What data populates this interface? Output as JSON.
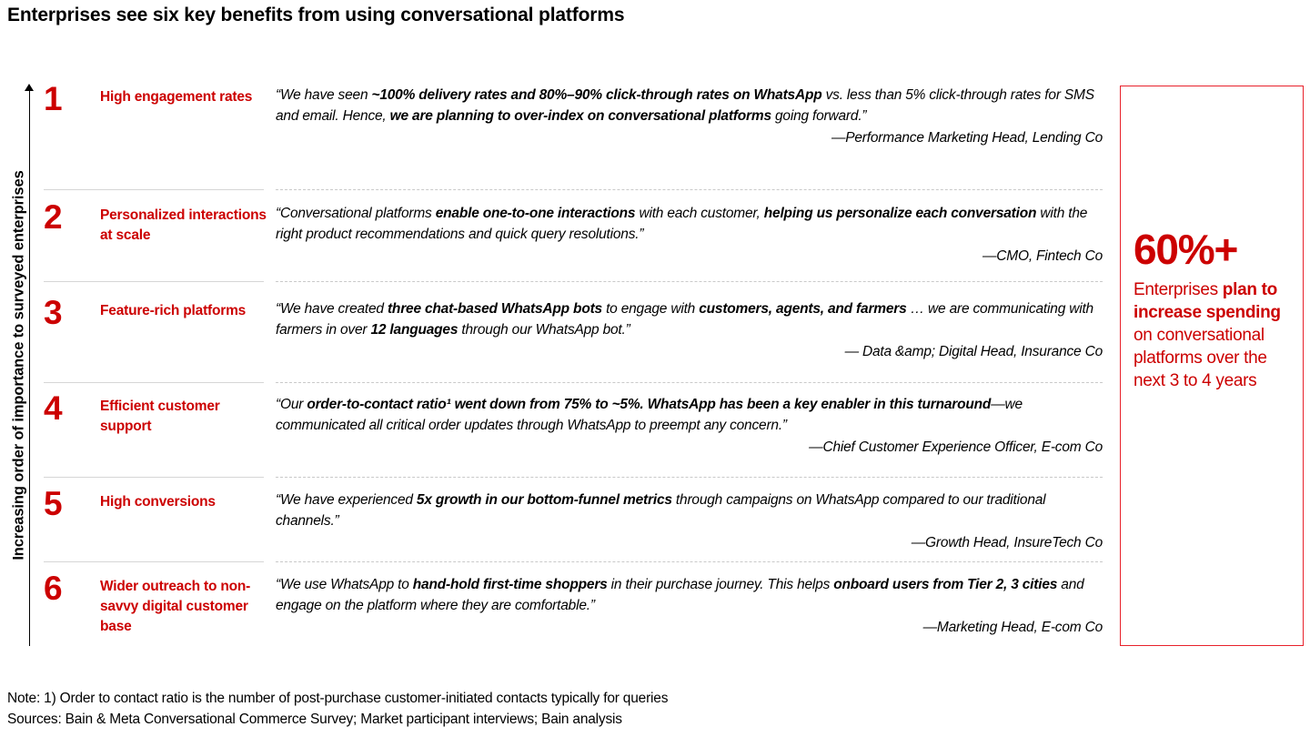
{
  "page_title": "Enterprises see six key benefits from using conversational platforms",
  "axis": {
    "label": "Increasing order of importance to surveyed enterprises",
    "direction_icon": "up-arrow-icon"
  },
  "colors": {
    "accent_red": "#CC0000",
    "callout_border": "#E8212B",
    "separator_gray": "#D6D6D6",
    "text_black": "#000000"
  },
  "rows": [
    {
      "number": "1",
      "benefit": "High engagement rates",
      "quote_html": "“We have seen <b>~100% delivery rates and 80%–90% click-through rates on WhatsApp</b> vs. less than 5% click-through rates for SMS and email. Hence, <b>we are planning to over-index on conversational platforms</b> going forward.”",
      "attribution": "—Performance Marketing Head, Lending Co"
    },
    {
      "number": "2",
      "benefit": "Personalized interactions at scale",
      "quote_html": "“Conversational platforms <b>enable one-to-one interactions</b> with each customer, <b>helping us personalize each conversation</b> with the right product recommendations and quick query resolutions.”",
      "attribution": "—CMO, Fintech Co"
    },
    {
      "number": "3",
      "benefit": "Feature-rich platforms",
      "quote_html": "“We have created <b>three chat-based WhatsApp bots</b> to engage with <b>customers, agents, and farmers</b> … we are communicating with farmers in over <b>12 languages</b> through our WhatsApp bot.”",
      "attribution": "— Data &amp; Digital Head, Insurance Co"
    },
    {
      "number": "4",
      "benefit": "Efficient customer support",
      "quote_html": "“Our <b>order-to-contact ratio¹ went down from 75% to ~5%. WhatsApp has been a key enabler in this turnaround</b>—we communicated all critical order updates through WhatsApp to preempt any concern.”",
      "attribution": "—Chief Customer Experience Officer, E-com Co"
    },
    {
      "number": "5",
      "benefit": "High conversions",
      "quote_html": "“We have experienced <b>5x growth in our bottom-funnel metrics</b> through campaigns on WhatsApp compared to our traditional channels.”",
      "attribution": "—Growth Head, InsureTech Co"
    },
    {
      "number": "6",
      "benefit": "Wider outreach to non-savvy digital customer base",
      "quote_html": "“We use WhatsApp to <b>hand-hold first-time shoppers</b> in their purchase journey. This helps <b>onboard users from Tier 2, 3 cities</b> and engage on the platform where they are comfortable.”",
      "attribution": "—Marketing Head, E-com Co"
    }
  ],
  "callout": {
    "stat": "60%+",
    "text_html": "Enterprises <b>plan to increase spending</b> on conversational platforms over the next 3 to 4 years"
  },
  "footer": {
    "note": "Note: 1) Order to contact ratio is the number of post-purchase customer-initiated contacts typically for queries",
    "sources": "Sources: Bain &amp; Meta Conversational Commerce Survey; Market participant interviews; Bain analysis"
  }
}
